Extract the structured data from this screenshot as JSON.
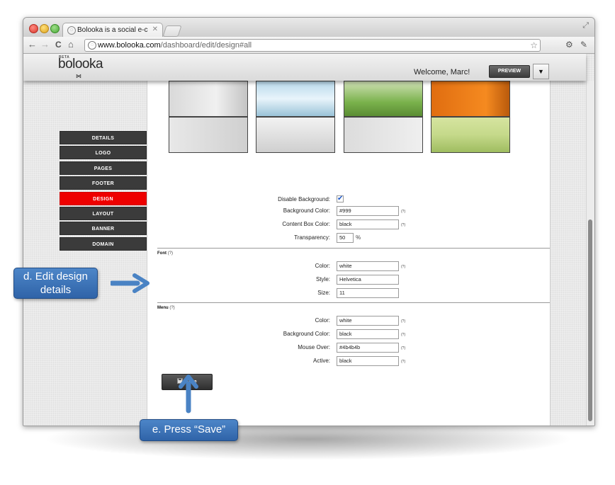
{
  "browser": {
    "tab_title": "Bolooka is a social e-comme",
    "tab_close": "✕",
    "url_host": "www.bolooka.com",
    "url_path": "/dashboard/edit/design#all",
    "back_glyph": "←",
    "forward_glyph": "→",
    "reload_glyph": "C",
    "home_glyph": "⌂",
    "star_glyph": "☆",
    "ext_glyph": "⚙",
    "wrench_glyph": "✎",
    "fullscreen_glyph": "⤢"
  },
  "site": {
    "logo_beta": "BETA",
    "logo": "bolooka",
    "logo_bow": "⋈",
    "welcome": "Welcome, Marc!",
    "preview": "PREVIEW",
    "dropdown": "▼"
  },
  "sidenav": {
    "items": [
      {
        "label": "DETAILS"
      },
      {
        "label": "LOGO"
      },
      {
        "label": "PAGES"
      },
      {
        "label": "FOOTER"
      },
      {
        "label": "DESIGN"
      },
      {
        "label": "LAYOUT"
      },
      {
        "label": "BANNER"
      },
      {
        "label": "DOMAIN"
      }
    ],
    "active_index": 4
  },
  "background_form": {
    "disable_bg_label": "Disable Background:",
    "disable_bg_checked": true,
    "checkmark": "✔",
    "bg_color_label": "Background Color:",
    "bg_color_value": "#999",
    "content_box_label": "Content Box Color:",
    "content_box_value": "black",
    "transparency_label": "Transparency:",
    "transparency_value": "50",
    "transparency_unit": "%",
    "help": "(?)"
  },
  "font_section": {
    "title": "Font",
    "help": "(?)",
    "color_label": "Color:",
    "color_value": "white",
    "style_label": "Style:",
    "style_value": "Helvetica",
    "size_label": "Size:",
    "size_value": "11"
  },
  "menu_section": {
    "title": "Menu",
    "help": "(?)",
    "color_label": "Color:",
    "color_value": "white",
    "bg_color_label": "Background Color:",
    "bg_color_value": "black",
    "mouse_over_label": "Mouse Over:",
    "mouse_over_value": "#4b4b4b",
    "active_label": "Active:",
    "active_value": "black"
  },
  "save": {
    "label": "Save"
  },
  "annotations": {
    "callout_d": "d. Edit design details",
    "callout_e": "e. Press “Save”"
  },
  "colors": {
    "accent_red": "#ee0000",
    "callout_blue": "#3b73b9",
    "nav_dark": "#3b3b3b"
  }
}
